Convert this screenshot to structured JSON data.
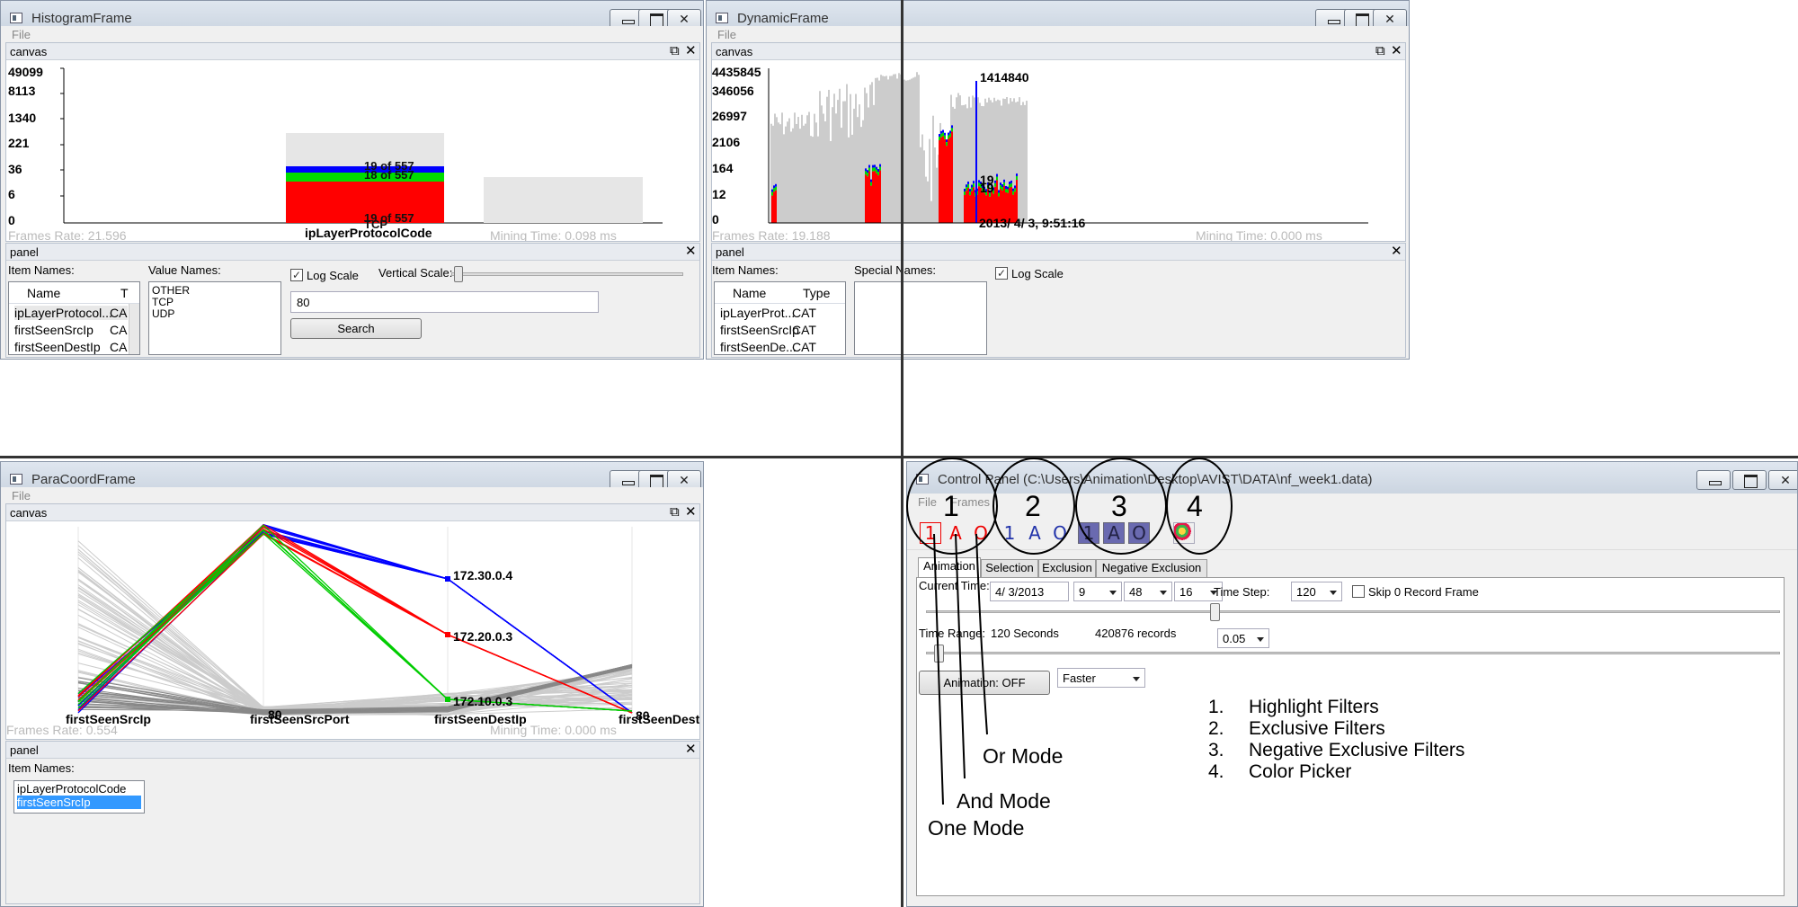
{
  "histogram": {
    "title": "HistogramFrame",
    "menu_file": "File",
    "canvas_label": "canvas",
    "panel_label": "panel",
    "chart_data": {
      "type": "bar",
      "log_scale": true,
      "y_ticks": [
        "49099",
        "8113",
        "1340",
        "221",
        "36",
        "6",
        "0"
      ],
      "categories": [
        "OTHER",
        "TCP",
        "UDP"
      ],
      "bars": [
        {
          "name": "OTHER",
          "total": 0
        },
        {
          "name": "TCP",
          "total": 557,
          "segments": [
            {
              "color": "#ff0000",
              "label": "19 of 557"
            },
            {
              "color": "#00dd00",
              "label": "18 of 557"
            },
            {
              "color": "#0000ff",
              "label": "19 of 557"
            }
          ]
        },
        {
          "name": "UDP",
          "total": 16
        }
      ],
      "visible_category_label": "TCP",
      "xlabel": "ipLayerProtocolCode"
    },
    "frames_rate": "Frames Rate: 21.596",
    "mining_time": "Mining Time: 0.098 ms",
    "item_names_label": "Item Names:",
    "value_names_label": "Value Names:",
    "log_scale_label": "Log Scale",
    "vertical_scale_label": "Vertical Scale:",
    "table_headers": [
      "Name",
      "T"
    ],
    "table_rows": [
      [
        "ipLayerProtocol...",
        "CA"
      ],
      [
        "firstSeenSrcIp",
        "CA"
      ],
      [
        "firstSeenDestIp",
        "CA"
      ]
    ],
    "value_names": [
      "OTHER",
      "TCP",
      "UDP"
    ],
    "search_value": "80",
    "search_button": "Search"
  },
  "dynamic": {
    "title": "DynamicFrame",
    "menu_file": "File",
    "canvas_label": "canvas",
    "panel_label": "panel",
    "chart_data": {
      "type": "area",
      "log_scale": true,
      "y_ticks": [
        "4435845",
        "346056",
        "26997",
        "2106",
        "164",
        "12",
        "0"
      ],
      "peak_label": "1414840",
      "marker_labels": [
        "19",
        "19"
      ],
      "cursor_time": "2013/ 4/ 3, 9:51:16",
      "series_colors": [
        "#cccccc",
        "#ff0000",
        "#00dd00",
        "#0000ff"
      ]
    },
    "frames_rate": "Frames Rate: 19.188",
    "mining_time": "Mining Time: 0.000 ms",
    "item_names_label": "Item Names:",
    "special_names_label": "Special Names:",
    "log_scale_label": "Log Scale",
    "table_headers": [
      "Name",
      "Type"
    ],
    "table_rows": [
      [
        "ipLayerProt...",
        "CAT"
      ],
      [
        "firstSeenSrcIp",
        "CAT"
      ],
      [
        "firstSeenDe...",
        "CAT"
      ]
    ]
  },
  "paracoord": {
    "title": "ParaCoordFrame",
    "menu_file": "File",
    "canvas_label": "canvas",
    "panel_label": "panel",
    "chart_data": {
      "type": "parallel-coordinates",
      "axes": [
        "firstSeenSrcIp",
        "firstSeenSrcPort",
        "firstSeenDestIp",
        "firstSeenDestPort"
      ],
      "labels": [
        {
          "text": "172.30.0.4",
          "color": "#0000ff"
        },
        {
          "text": "172.20.0.3",
          "color": "#ff0000"
        },
        {
          "text": "172.10.0.3",
          "color": "#00cc00"
        },
        {
          "text": "80",
          "color": "#000000"
        },
        {
          "text": "80",
          "color": "#000000"
        }
      ]
    },
    "frames_rate": "Frames Rate: 0.554",
    "mining_time": "Mining Time: 0.000 ms",
    "item_names_label": "Item Names:",
    "list_items": [
      "ipLayerProtocolCode",
      "firstSeenSrcIp"
    ]
  },
  "control": {
    "title": "Control Panel (C:\\Users\\Animation\\Desktop\\AVIST\\DATA\\nf_week1.data)",
    "menu_file": "File",
    "menu_frames": "Frames",
    "tabs": [
      "Animation",
      "Selection",
      "Exclusion",
      "Negative Exclusion"
    ],
    "current_time_label": "Current Time:",
    "date_value": "4/  3/2013",
    "hour_value": "9",
    "minute_value": "48",
    "second_value": "16",
    "time_step_label": "Time Step:",
    "time_step_value": "120",
    "skip_label": "Skip 0 Record Frame",
    "time_range_label": "Time Range:",
    "range_seconds": "120 Seconds",
    "range_records": "420876 records",
    "range_select": "0.05",
    "animation_button": "Animation: OFF",
    "speed_select": "Faster",
    "toolbar_glyphs": [
      "1",
      "A",
      "O",
      "1",
      "A",
      "O",
      "1",
      "A",
      "O"
    ],
    "group_numbers": [
      "1",
      "2",
      "3",
      "4"
    ],
    "callouts": [
      "Or Mode",
      "And Mode",
      "One Mode"
    ],
    "legend": [
      {
        "num": "1.",
        "text": "Highlight Filters"
      },
      {
        "num": "2.",
        "text": "Exclusive Filters"
      },
      {
        "num": "3.",
        "text": "Negative Exclusive Filters"
      },
      {
        "num": "4.",
        "text": "Color Picker"
      }
    ]
  }
}
